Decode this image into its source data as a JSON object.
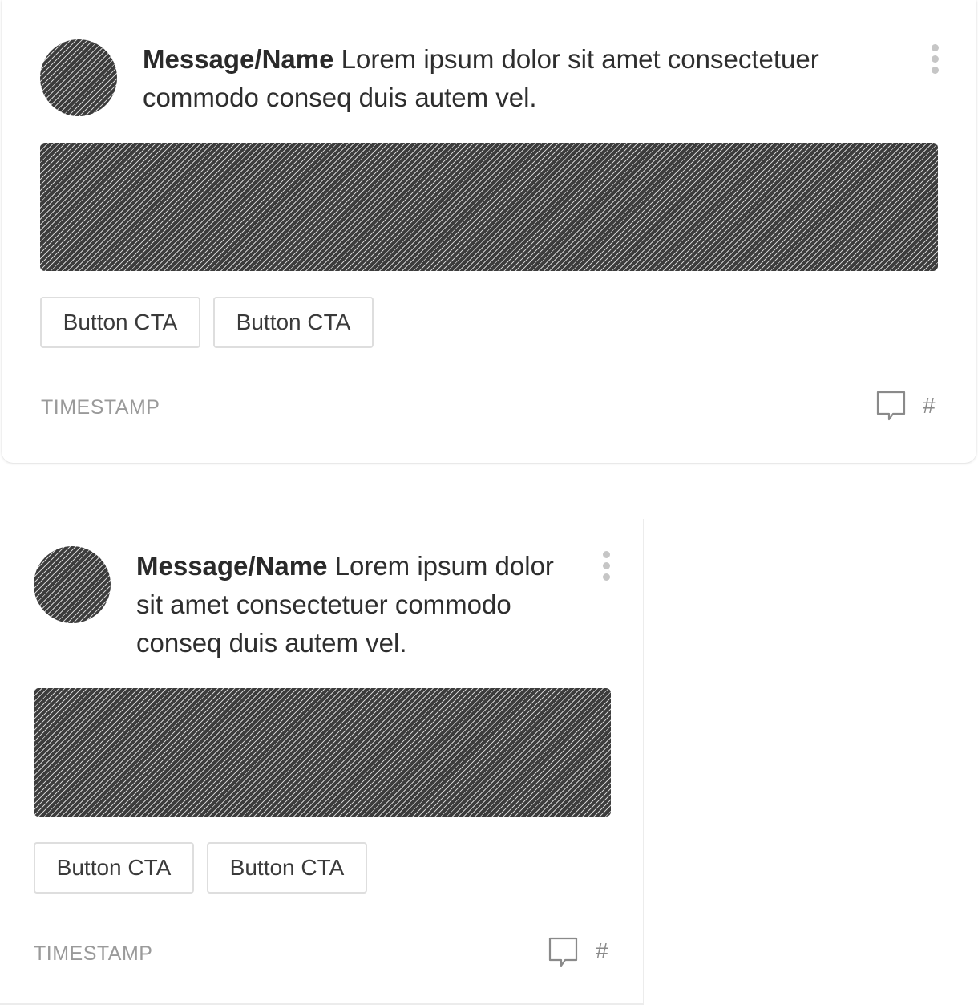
{
  "cards": [
    {
      "message_name": "Message/Name",
      "message_text": " Lorem ipsum dolor sit amet consectetuer commodo conseq duis autem vel.",
      "buttons": [
        "Button CTA",
        "Button CTA"
      ],
      "timestamp": "TIMESTAMP",
      "comment_count": "#",
      "more_icon": "more-vertical-icon",
      "comment_icon": "comment-icon"
    },
    {
      "message_name": "Message/Name",
      "message_text": " Lorem ipsum dolor sit amet consectetuer commodo conseq duis autem vel.",
      "buttons": [
        "Button CTA",
        "Button CTA"
      ],
      "timestamp": "TIMESTAMP",
      "comment_count": "#",
      "more_icon": "more-vertical-icon",
      "comment_icon": "comment-icon"
    }
  ],
  "colors": {
    "text": "#2e2e2e",
    "muted": "#9a9a9a",
    "placeholder_dark": "#3c3c3c",
    "border": "#dedede",
    "kebab": "#c6c6c6"
  }
}
